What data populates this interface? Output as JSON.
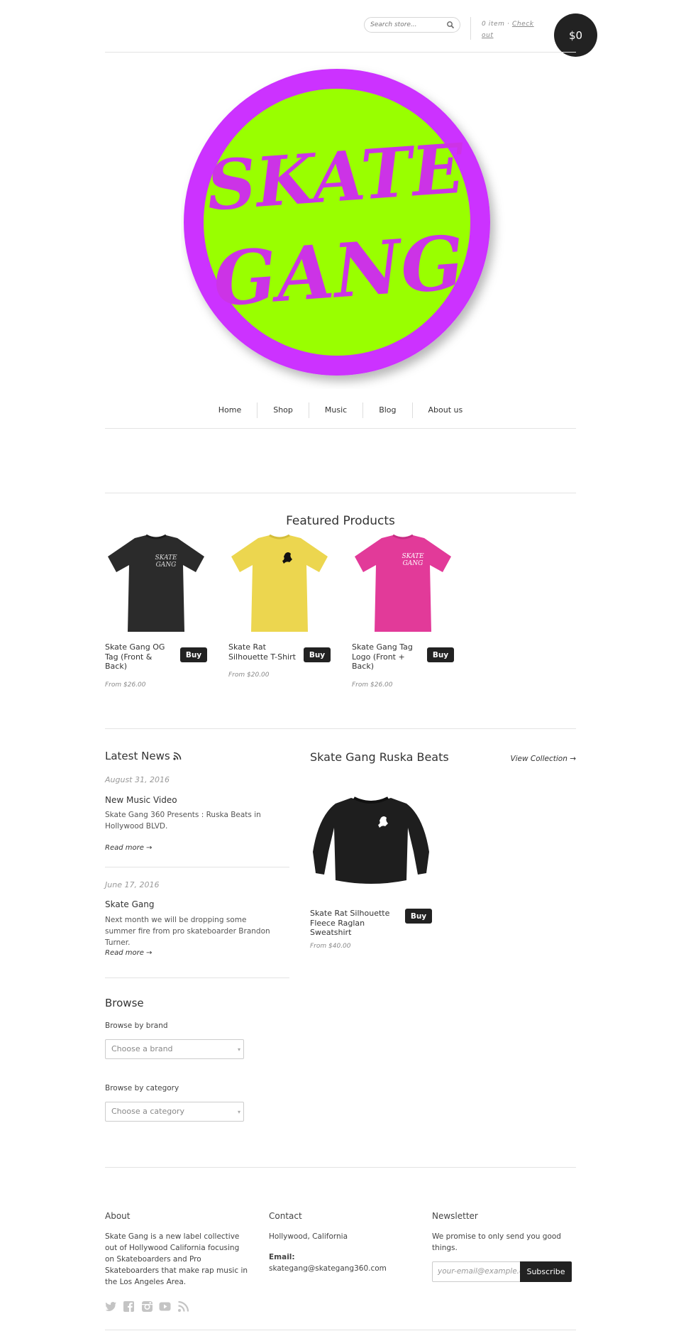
{
  "header": {
    "search_placeholder": "Search store...",
    "cart_items": "0 item",
    "separator": "·",
    "checkout_label": "Check out",
    "cart_total": "$0"
  },
  "brand": {
    "logo_line1": "SKATE",
    "logo_line2": "GANG",
    "logo_ring_color": "#CC33FF",
    "logo_fill_color": "#99FF00",
    "logo_text_color": "#CC33E6"
  },
  "nav": {
    "items": [
      "Home",
      "Shop",
      "Music",
      "Blog",
      "About us"
    ]
  },
  "featured": {
    "title": "Featured Products",
    "buy_label": "Buy",
    "products": [
      {
        "name": "Skate Gang OG Tag (Front & Back)",
        "price": "From $26.00",
        "color": "#2b2b2b"
      },
      {
        "name": "Skate Rat Silhouette T-Shirt",
        "price": "From $20.00",
        "color": "#ecd64f"
      },
      {
        "name": "Skate Gang Tag Logo (Front + Back)",
        "price": "From $26.00",
        "color": "#e23a99"
      }
    ]
  },
  "news": {
    "title": "Latest News",
    "read_more": "Read more →",
    "posts": [
      {
        "date": "August 31, 2016",
        "title": "New Music Video",
        "body": "Skate Gang 360 Presents : Ruska Beats in Hollywood BLVD."
      },
      {
        "date": "June 17, 2016",
        "title": "Skate Gang",
        "body": "Next month we will be dropping some summer fire from pro skateboarder Brandon Turner."
      }
    ]
  },
  "collection": {
    "title": "Skate Gang Ruska Beats",
    "view_label": "View Collection →",
    "product": {
      "name": "Skate Rat Silhouette Fleece Raglan Sweatshirt",
      "price": "From $40.00",
      "buy_label": "Buy"
    }
  },
  "browse": {
    "title": "Browse",
    "brand_label": "Browse by brand",
    "brand_placeholder": "Choose a brand",
    "category_label": "Browse by category",
    "category_placeholder": "Choose a category"
  },
  "footer": {
    "about_title": "About",
    "about_text": "Skate Gang is a new label collective out of Hollywood California focusing on Skateboarders and Pro Skateboarders that make rap music in the Los Angeles Area.",
    "contact_title": "Contact",
    "contact_location": "Hollywood, California",
    "email_label": "Email:",
    "email_value": "skategang@skategang360.com",
    "newsletter_title": "Newsletter",
    "newsletter_text": "We promise to only send you good things.",
    "newsletter_placeholder": "your-email@example.com",
    "subscribe_label": "Subscribe",
    "social_icons": [
      "twitter-icon",
      "facebook-icon",
      "instagram-icon",
      "youtube-icon",
      "rss-icon"
    ]
  }
}
